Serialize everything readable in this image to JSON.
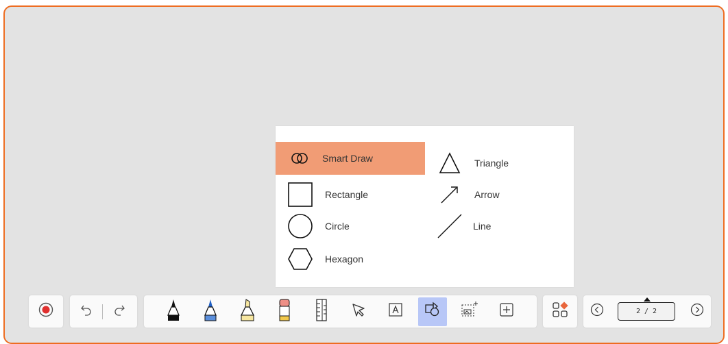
{
  "shape_menu": {
    "items": [
      {
        "label": "Smart Draw",
        "icon": "smart-draw-icon",
        "selected": true
      },
      {
        "label": "Triangle",
        "icon": "triangle-icon",
        "selected": false
      },
      {
        "label": "Rectangle",
        "icon": "rectangle-icon",
        "selected": false
      },
      {
        "label": "Arrow",
        "icon": "arrow-icon",
        "selected": false
      },
      {
        "label": "Circle",
        "icon": "circle-icon",
        "selected": false
      },
      {
        "label": "Line",
        "icon": "line-icon",
        "selected": false
      },
      {
        "label": "Hexagon",
        "icon": "hexagon-icon",
        "selected": false
      }
    ]
  },
  "toolbar": {
    "record_icon": "record-icon",
    "undo_icon": "undo-icon",
    "redo_icon": "redo-icon",
    "tools": [
      {
        "icon": "black-pen-icon"
      },
      {
        "icon": "blue-pen-icon"
      },
      {
        "icon": "highlighter-icon"
      },
      {
        "icon": "eraser-icon"
      },
      {
        "icon": "ruler-icon"
      },
      {
        "icon": "select-icon"
      },
      {
        "icon": "text-icon"
      },
      {
        "icon": "shapes-icon",
        "active": true
      },
      {
        "icon": "image-insert-icon"
      },
      {
        "icon": "add-icon"
      }
    ],
    "apps_icon": "apps-icon",
    "pager": {
      "page_label": "2 / 2"
    }
  },
  "colors": {
    "board_border": "#ee6d22",
    "board_bg": "#e3e3e3",
    "menu_selected": "#f19c75",
    "active_tool": "#b8c7f7",
    "record_red": "#e0302f"
  }
}
